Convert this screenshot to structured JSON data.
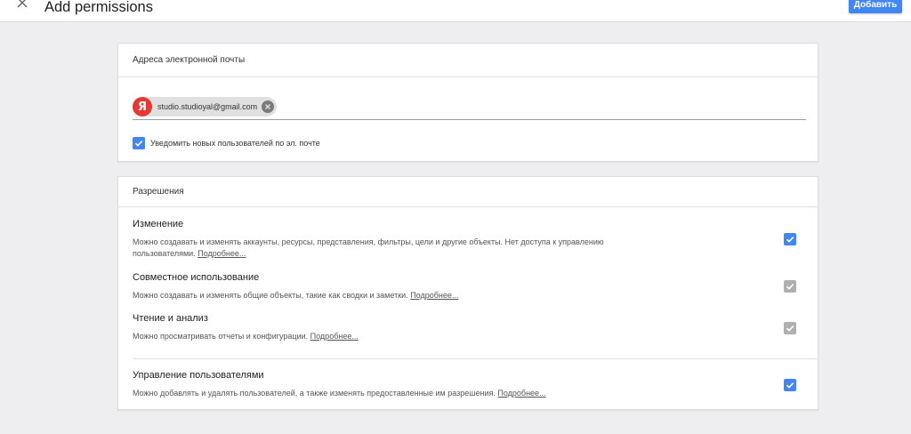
{
  "header": {
    "title": "Add permissions",
    "add_button_label": "Добавить"
  },
  "email_section": {
    "title": "Адреса электронной почты",
    "chip": {
      "avatar_letter": "Я",
      "email": "studio.studioyal@gmail.com",
      "avatar_color": "#e53935"
    },
    "notify": {
      "checked": true,
      "label": "Уведомить новых пользователей по эл. почте"
    }
  },
  "permissions_section": {
    "title": "Разрешения",
    "items": [
      {
        "title": "Изменение",
        "description": "Можно создавать и изменять аккаунты, ресурсы, представления, фильтры, цели и другие объекты. Нет доступа к управлению пользователями.",
        "link": "Подробнее...",
        "checked": true,
        "enabled": true
      },
      {
        "title": "Совместное использование",
        "description": "Можно создавать и изменять общие объекты, такие как сводки и заметки.",
        "link": "Подробнее...",
        "checked": true,
        "enabled": false
      },
      {
        "title": "Чтение и анализ",
        "description": "Можно просматривать отчеты и конфигурации.",
        "link": "Подробнее...",
        "checked": true,
        "enabled": false
      },
      {
        "title": "Управление пользователями",
        "description": "Можно добавлять и удалять пользователей, а также изменять предоставленные им разрешения.",
        "link": "Подробнее...",
        "checked": true,
        "enabled": true
      }
    ]
  },
  "colors": {
    "accent": "#4285f4",
    "disabled_check": "#b0b0b0",
    "background": "#eeeef0"
  }
}
